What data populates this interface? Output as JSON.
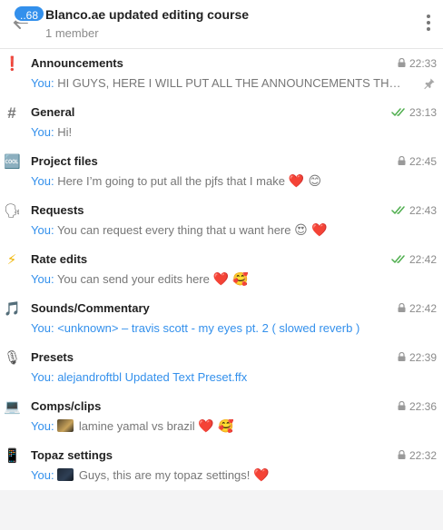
{
  "header": {
    "unread_count": "..68",
    "title": "Blanco.ae updated editing course",
    "subtitle": "1 member"
  },
  "colors": {
    "accent": "#3390ec",
    "check": "#4fae4e",
    "muted": "#8b8b8b"
  },
  "topics": [
    {
      "icon": "exclamation-icon",
      "glyph": "❗",
      "name": "Announcements",
      "status": "lock",
      "time": "22:33",
      "sender": "You:",
      "text": "HI GUYS, HERE I WILL PUT ALL THE ANNOUNCEMENTS THAT IT ...",
      "emoji": "",
      "pinned": true
    },
    {
      "icon": "hash-icon",
      "glyph": "#",
      "name": "General",
      "status": "read",
      "time": "23:13",
      "sender": "You:",
      "text": "Hi!",
      "emoji": ""
    },
    {
      "icon": "cool-icon",
      "glyph": "🆒",
      "name": "Project files",
      "status": "lock",
      "time": "22:45",
      "sender": "You:",
      "text": "Here I’m going to put all the pjfs that I make",
      "emoji": "❤️ 😊"
    },
    {
      "icon": "speaking-head-icon",
      "glyph": "🗣",
      "name": "Requests",
      "status": "read",
      "time": "22:43",
      "sender": "You:",
      "text": "You can request every thing that u want here",
      "emoji": "😍 ❤️"
    },
    {
      "icon": "lightning-icon",
      "glyph": "⚡",
      "name": "Rate edits",
      "status": "read",
      "time": "22:42",
      "sender": "You:",
      "text": "You can send your edits here",
      "emoji": "❤️ 🥰"
    },
    {
      "icon": "music-note-icon",
      "glyph": "🎵",
      "name": "Sounds/Commentary",
      "status": "lock",
      "time": "22:42",
      "sender": "You:",
      "text": "<unknown> – travis scott - my eyes pt. 2 ( slowed  reverb )",
      "emoji": "",
      "link": true
    },
    {
      "icon": "microphone-icon",
      "glyph": "🎙",
      "name": "Presets",
      "status": "lock",
      "time": "22:39",
      "sender": "You:",
      "text": "alejandroftbl Updated Text Preset.ffx",
      "emoji": "",
      "link": true
    },
    {
      "icon": "laptop-icon",
      "glyph": "💻",
      "name": "Comps/clips",
      "status": "lock",
      "time": "22:36",
      "sender": "You:",
      "text": "lamine yamal vs brazil",
      "emoji": "❤️ 🥰",
      "thumb": "a"
    },
    {
      "icon": "phone-icon",
      "glyph": "📱",
      "name": "Topaz settings",
      "status": "lock",
      "time": "22:32",
      "sender": "You:",
      "text": "Guys, this are my topaz settings!",
      "emoji": "❤️",
      "thumb": "b"
    }
  ]
}
